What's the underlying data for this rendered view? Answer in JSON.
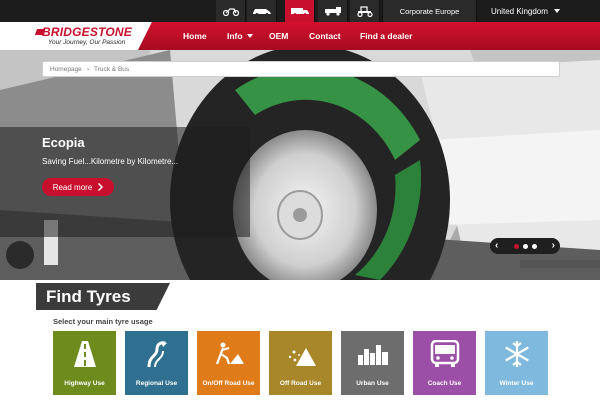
{
  "topbar": {
    "vehicle_tabs": [
      {
        "name": "motorcycle-icon"
      },
      {
        "name": "car-icon"
      },
      {
        "name": "truck-bus-icon",
        "active": true
      },
      {
        "name": "agricultural-icon"
      },
      {
        "name": "tractor-icon"
      }
    ],
    "corporate_label": "Corporate Europe",
    "country_label": "United Kingdom"
  },
  "logo": {
    "brand": "BRIDGESTONE",
    "tagline": "Your Journey, Our Passion"
  },
  "nav": {
    "items": [
      {
        "label": "Home"
      },
      {
        "label": "Info",
        "has_dropdown": true
      },
      {
        "label": "OEM"
      },
      {
        "label": "Contact"
      },
      {
        "label": "Find a dealer"
      }
    ]
  },
  "breadcrumb": {
    "items": [
      "Homepage",
      "Truck & Bus"
    ]
  },
  "hero": {
    "title": "Ecopia",
    "text": "Saving Fuel...Kilometre by Kilometre...",
    "button_label": "Read more",
    "slide_count": 3,
    "active_slide": 1
  },
  "find_tyres": {
    "title": "Find Tyres",
    "subtitle": "Select your main tyre usage",
    "tiles": [
      {
        "label": "Highway Use",
        "color": "#6e8b1e",
        "icon": "highway-icon"
      },
      {
        "label": "Regional Use",
        "color": "#2f6f8f",
        "icon": "regional-icon"
      },
      {
        "label": "On/Off Road Use",
        "color": "#e07b1a",
        "icon": "construction-icon"
      },
      {
        "label": "Off Road Use",
        "color": "#a8862a",
        "icon": "off-road-icon"
      },
      {
        "label": "Urban Use",
        "color": "#6d6d6d",
        "icon": "city-icon"
      },
      {
        "label": "Coach Use",
        "color": "#9b4fa6",
        "icon": "bus-icon"
      },
      {
        "label": "Winter Use",
        "color": "#7fb9dd",
        "icon": "snowflake-icon"
      }
    ]
  },
  "colors": {
    "brand_red": "#c8102e",
    "dark": "#1c1c1c"
  }
}
